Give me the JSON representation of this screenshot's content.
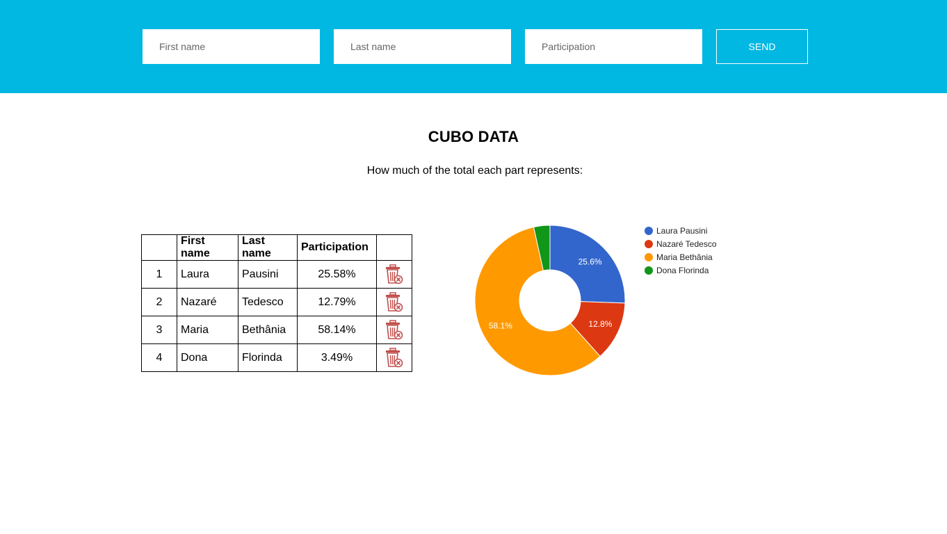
{
  "form": {
    "first_name_placeholder": "First name",
    "last_name_placeholder": "Last name",
    "participation_placeholder": "Participation",
    "send_label": "SEND"
  },
  "page": {
    "title": "CUBO DATA",
    "subtitle": "How much of the total each part represents:"
  },
  "table": {
    "headers": [
      "",
      "First name",
      "Last name",
      "Participation",
      ""
    ],
    "rows": [
      {
        "index": "1",
        "first": "Laura",
        "last": "Pausini",
        "participation": "25.58%"
      },
      {
        "index": "2",
        "first": "Nazaré",
        "last": "Tedesco",
        "participation": "12.79%"
      },
      {
        "index": "3",
        "first": "Maria",
        "last": "Bethânia",
        "participation": "58.14%"
      },
      {
        "index": "4",
        "first": "Dona",
        "last": "Florinda",
        "participation": "3.49%"
      }
    ],
    "delete_icon": "trash-delete-icon",
    "delete_color": "#c0504d"
  },
  "chart_data": {
    "type": "pie",
    "donut": true,
    "categories": [
      "Laura Pausini",
      "Nazaré Tedesco",
      "Maria Bethânia",
      "Dona Florinda"
    ],
    "values": [
      25.58,
      12.79,
      58.14,
      3.49
    ],
    "slice_labels": [
      "25.6%",
      "12.8%",
      "58.1%",
      ""
    ],
    "colors": [
      "#3366cc",
      "#dc3912",
      "#ff9900",
      "#109618"
    ],
    "legend_position": "right"
  }
}
